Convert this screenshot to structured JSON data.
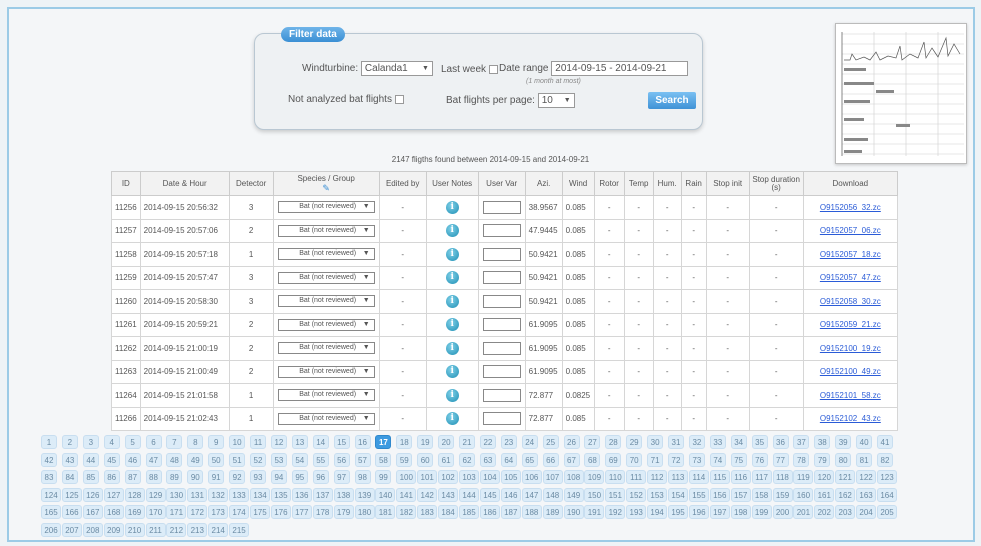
{
  "filter": {
    "legend": "Filter data",
    "windturbine_label": "Windturbine:",
    "windturbine_value": "Calanda1",
    "lastweek_label": "Last week",
    "daterange_label": "Date range",
    "daterange_value": "2014-09-15 - 2014-09-21",
    "daterange_hint": "(1 month at most)",
    "not_analyzed_label": "Not analyzed bat flights",
    "per_page_label": "Bat flights per page:",
    "per_page_value": "10",
    "search_label": "Search"
  },
  "summary": "2147 fligths found between 2014-09-15 and 2014-09-21",
  "table": {
    "headers": [
      "ID",
      "Date & Hour",
      "Detector",
      "Species / Group",
      "Edited by",
      "User Notes",
      "User Var",
      "Azi.",
      "Wind",
      "Rotor",
      "Temp",
      "Hum.",
      "Rain",
      "Stop init",
      "Stop duration (s)",
      "Download"
    ],
    "species_default": "Bat (not reviewed)",
    "rows": [
      {
        "id": "11256",
        "date": "2014-09-15 20:56:32",
        "detector": "3",
        "azi": "38.9567",
        "wind": "0.085",
        "file": "O9152056_32.zc"
      },
      {
        "id": "11257",
        "date": "2014-09-15 20:57:06",
        "detector": "2",
        "azi": "47.9445",
        "wind": "0.085",
        "file": "O9152057_06.zc"
      },
      {
        "id": "11258",
        "date": "2014-09-15 20:57:18",
        "detector": "1",
        "azi": "50.9421",
        "wind": "0.085",
        "file": "O9152057_18.zc"
      },
      {
        "id": "11259",
        "date": "2014-09-15 20:57:47",
        "detector": "3",
        "azi": "50.9421",
        "wind": "0.085",
        "file": "O9152057_47.zc"
      },
      {
        "id": "11260",
        "date": "2014-09-15 20:58:30",
        "detector": "3",
        "azi": "50.9421",
        "wind": "0.085",
        "file": "O9152058_30.zc"
      },
      {
        "id": "11261",
        "date": "2014-09-15 20:59:21",
        "detector": "2",
        "azi": "61.9095",
        "wind": "0.085",
        "file": "O9152059_21.zc"
      },
      {
        "id": "11262",
        "date": "2014-09-15 21:00:19",
        "detector": "2",
        "azi": "61.9095",
        "wind": "0.085",
        "file": "O9152100_19.zc"
      },
      {
        "id": "11263",
        "date": "2014-09-15 21:00:49",
        "detector": "2",
        "azi": "61.9095",
        "wind": "0.085",
        "file": "O9152100_49.zc"
      },
      {
        "id": "11264",
        "date": "2014-09-15 21:01:58",
        "detector": "1",
        "azi": "72.877",
        "wind": "0.0825",
        "file": "O9152101_58.zc"
      },
      {
        "id": "11266",
        "date": "2014-09-15 21:02:43",
        "detector": "1",
        "azi": "72.877",
        "wind": "0.085",
        "file": "O9152102_43.zc"
      }
    ],
    "dash": "-"
  },
  "pagination": {
    "total_pages": 215,
    "current": 17
  }
}
